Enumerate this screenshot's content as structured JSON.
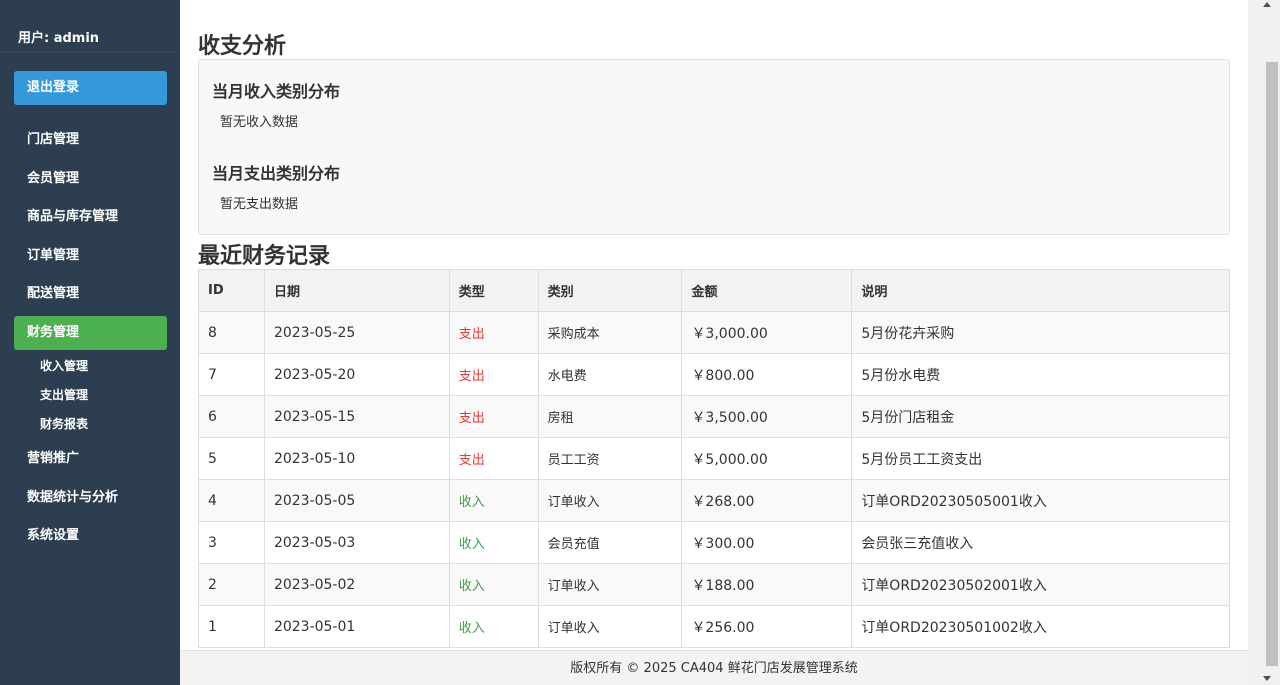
{
  "sidebar": {
    "user": "用户: admin",
    "logout": "退出登录",
    "items": [
      {
        "label": "门店管理"
      },
      {
        "label": "会员管理"
      },
      {
        "label": "商品与库存管理"
      },
      {
        "label": "订单管理"
      },
      {
        "label": "配送管理"
      },
      {
        "label": "财务管理"
      },
      {
        "label": "营销推广"
      },
      {
        "label": "数据统计与分析"
      },
      {
        "label": "系统设置"
      }
    ],
    "sub_items": [
      {
        "label": "收入管理"
      },
      {
        "label": "支出管理"
      },
      {
        "label": "财务报表"
      }
    ],
    "active_color": "#4caf50",
    "logout_color": "#3498db"
  },
  "analysis": {
    "title": "收支分析",
    "income_title": "当月收入类别分布",
    "income_empty": "暂无收入数据",
    "expense_title": "当月支出类别分布",
    "expense_empty": "暂无支出数据"
  },
  "records": {
    "title": "最近财务记录",
    "headers": [
      "ID",
      "日期",
      "类型",
      "类别",
      "金额",
      "说明"
    ],
    "rows": [
      [
        "8",
        "2023-05-25",
        "支出",
        "采购成本",
        "￥3,000.00",
        "5月份花卉采购"
      ],
      [
        "7",
        "2023-05-20",
        "支出",
        "水电费",
        "￥800.00",
        "5月份水电费"
      ],
      [
        "6",
        "2023-05-15",
        "支出",
        "房租",
        "￥3,500.00",
        "5月份门店租金"
      ],
      [
        "5",
        "2023-05-10",
        "支出",
        "员工工资",
        "￥5,000.00",
        "5月份员工工资支出"
      ],
      [
        "4",
        "2023-05-05",
        "收入",
        "订单收入",
        "￥268.00",
        "订单ORD20230505001收入"
      ],
      [
        "3",
        "2023-05-03",
        "收入",
        "会员充值",
        "￥300.00",
        "会员张三充值收入"
      ],
      [
        "2",
        "2023-05-02",
        "收入",
        "订单收入",
        "￥188.00",
        "订单ORD20230502001收入"
      ],
      [
        "1",
        "2023-05-01",
        "收入",
        "订单收入",
        "￥256.00",
        "订单ORD20230501002收入"
      ]
    ],
    "expense_color": "#e53935",
    "income_color": "#43a047"
  },
  "footer": {
    "text": "版权所有 © 2025 CA404 鲜花门店发展管理系统"
  }
}
